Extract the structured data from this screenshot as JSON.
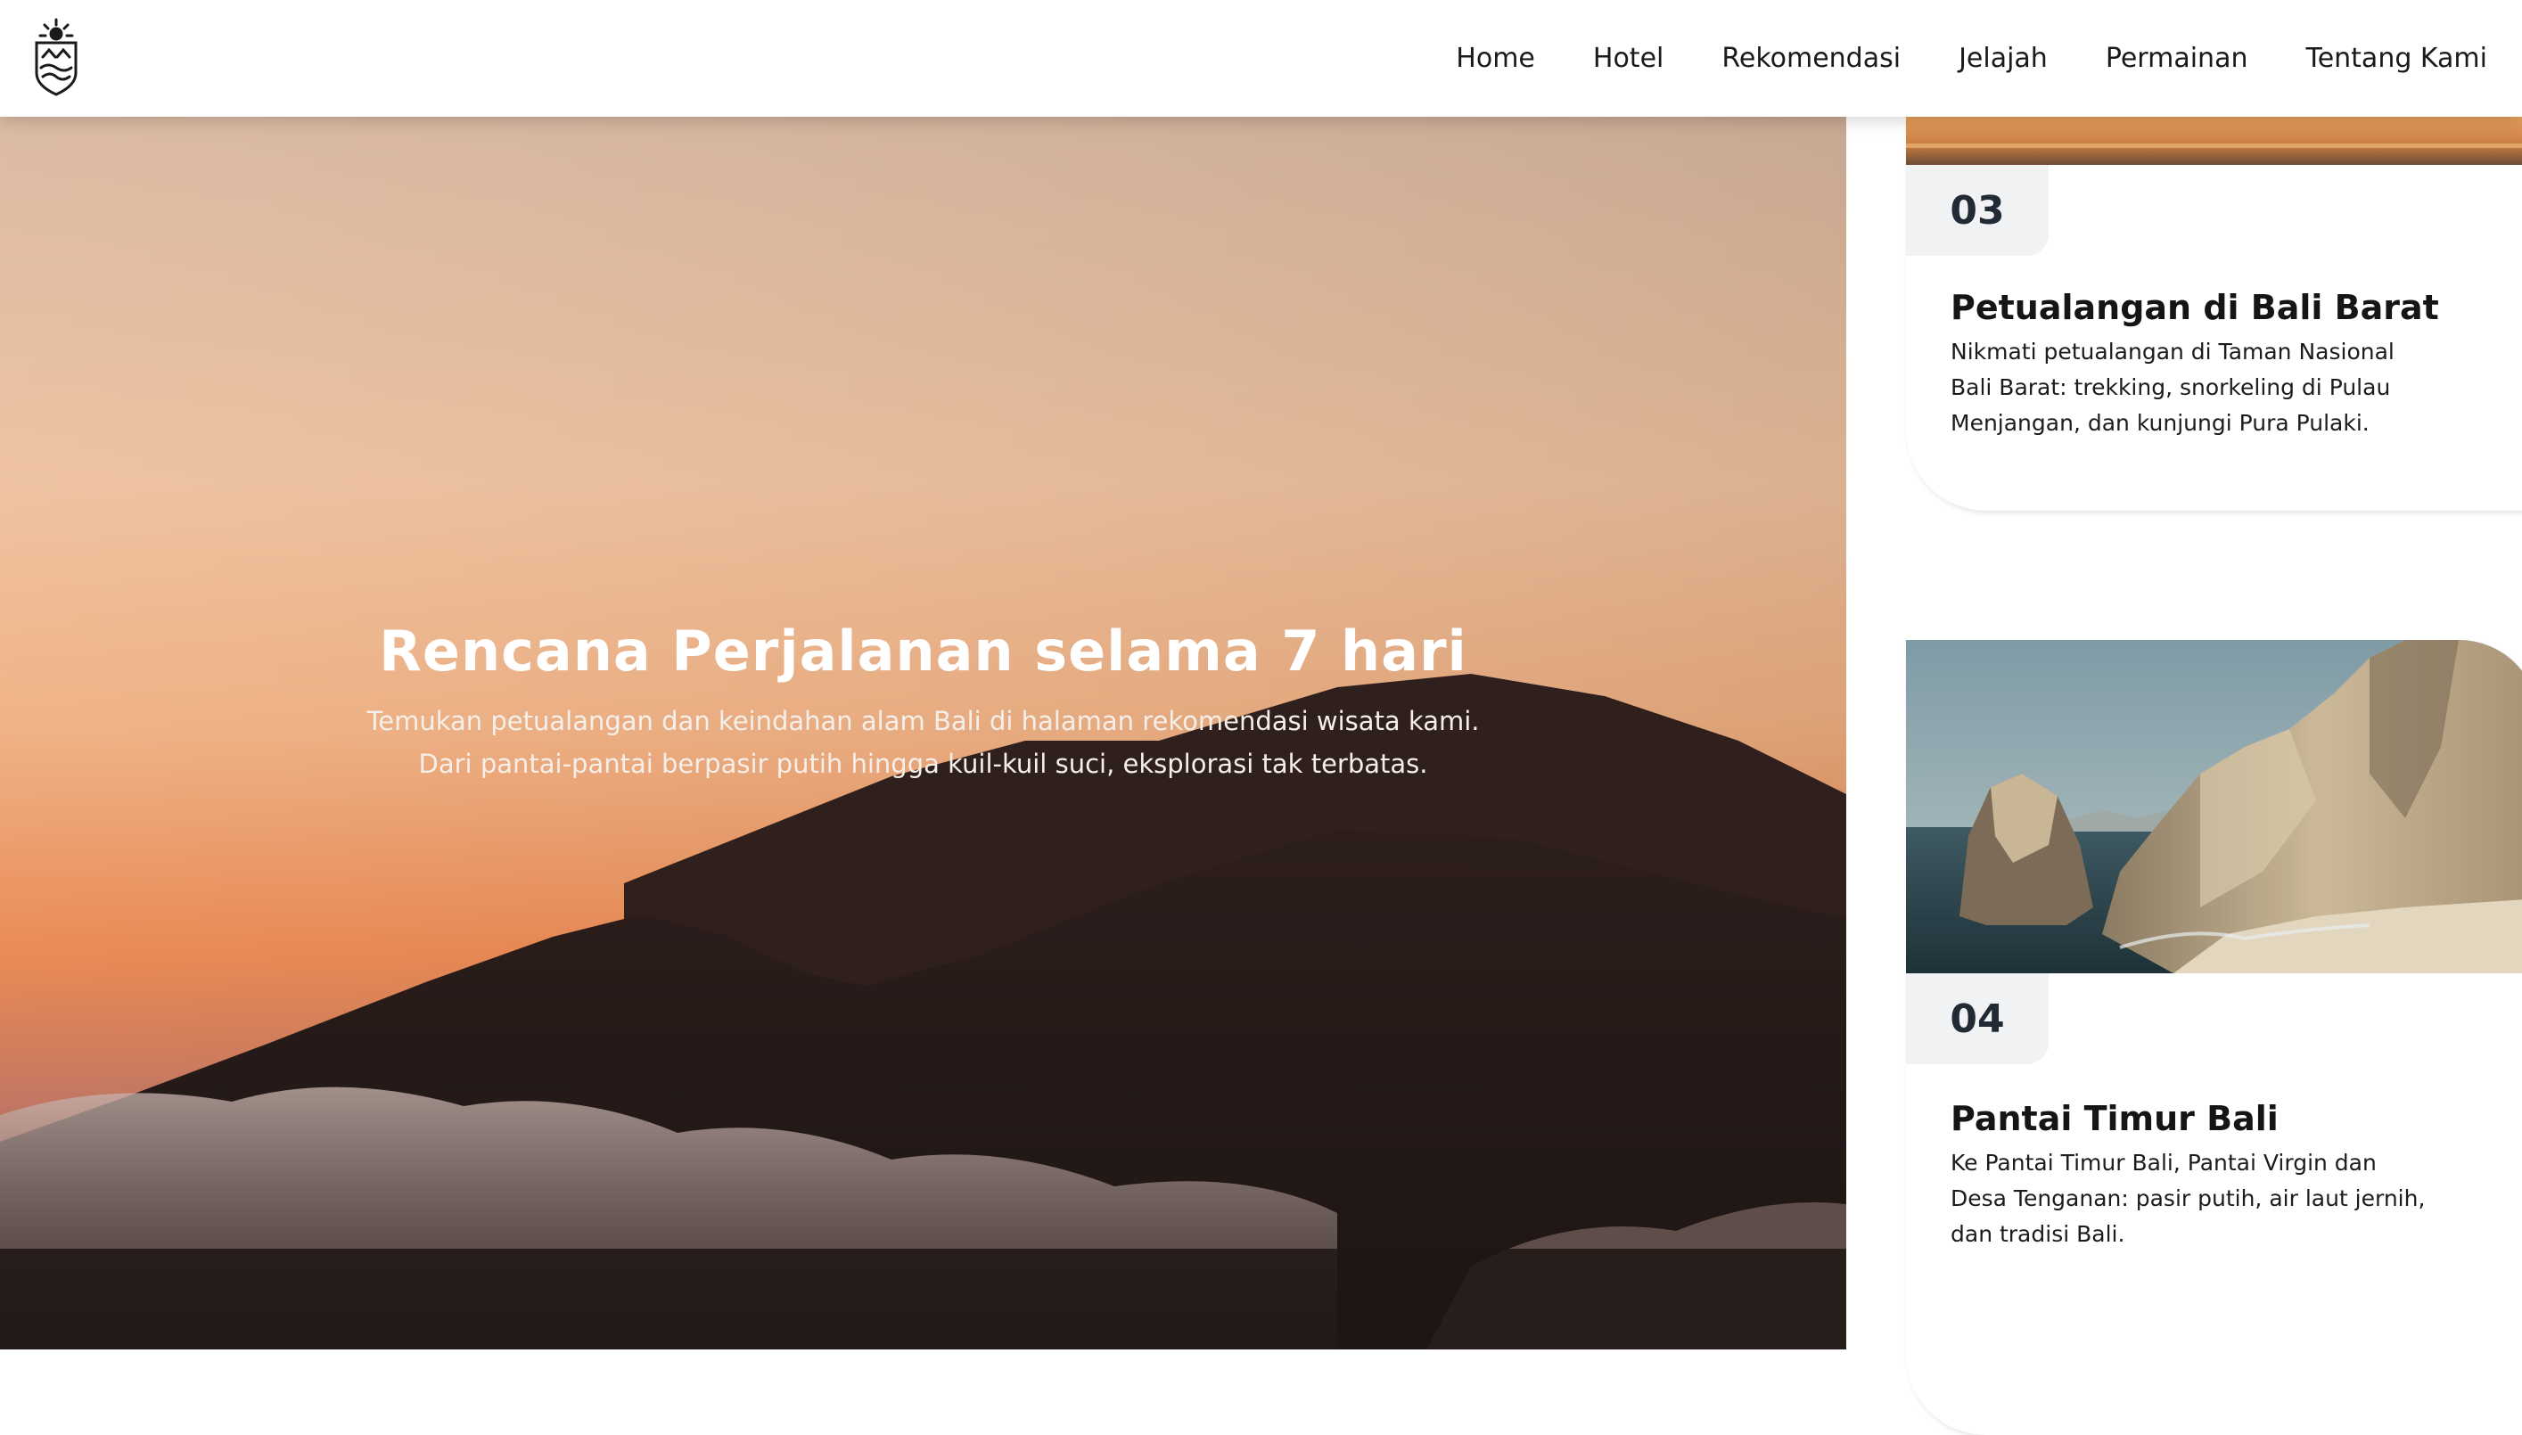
{
  "nav": {
    "logo_icon": "shield-temple-logo-icon",
    "links": [
      "Home",
      "Hotel",
      "Rekomendasi",
      "Jelajah",
      "Permainan",
      "Tentang Kami"
    ]
  },
  "hero": {
    "title": "Rencana Perjalanan selama 7 hari",
    "desc_line1": "Temukan petualangan dan keindahan alam Bali di halaman rekomendasi wisata kami.",
    "desc_line2": "Dari pantai-pantai berpasir putih hingga kuil-kuil suci, eksplorasi tak terbatas.",
    "image": "sunset-volcano-silhouette-image"
  },
  "cards": [
    {
      "number": "03",
      "title": "Petualangan di Bali Barat",
      "desc_lines": [
        "Nikmati petualangan di Taman Nasional",
        "Bali Barat: trekking, snorkeling di Pulau",
        "Menjangan, dan kunjungi Pura Pulaki."
      ],
      "image": "sunset-horizon-image"
    },
    {
      "number": "04",
      "title": "Pantai Timur Bali",
      "desc_lines": [
        "Ke Pantai Timur Bali, Pantai Virgin dan",
        "Desa Tenganan: pasir putih, air laut jernih,",
        "dan tradisi Bali."
      ],
      "image": "sea-cliffs-beach-image"
    }
  ],
  "colors": {
    "sky_top": "#d9b79f",
    "sky_mid": "#f0b98f",
    "sky_low": "#e8844a",
    "mountain": "#2b1c19",
    "card_number_bg": "#f1f2f4",
    "card_number_text": "#222a36"
  }
}
